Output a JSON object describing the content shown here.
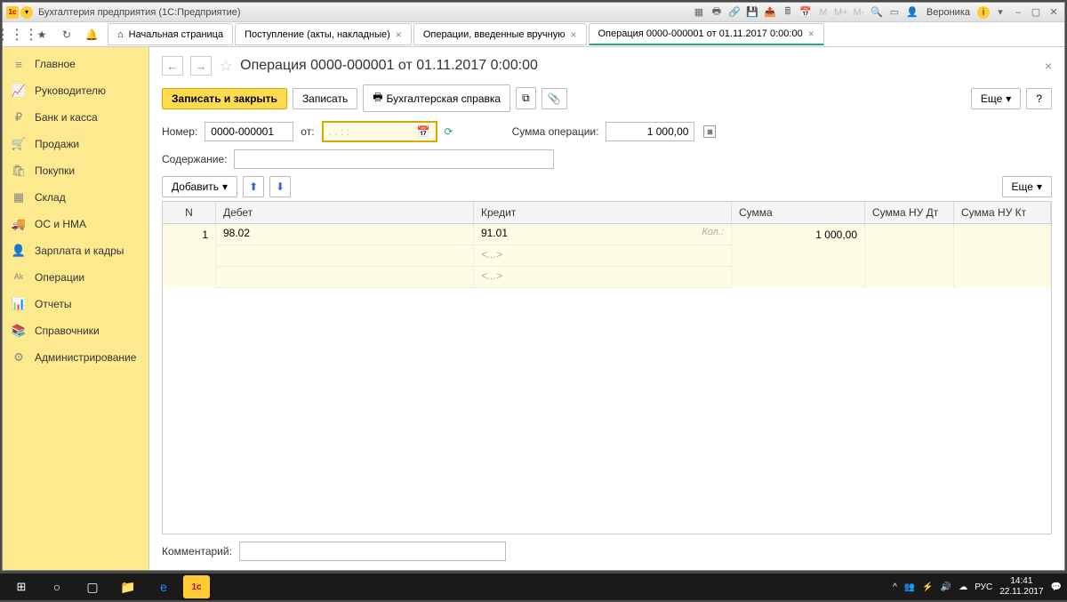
{
  "titlebar": {
    "app_icon": "1c",
    "text": "Бухгалтерия предприятия  (1С:Предприятие)",
    "user": "Вероника"
  },
  "toolbar": {
    "home_tab": "Начальная страница",
    "tabs": [
      "Поступление (акты, накладные)",
      "Операции, введенные вручную",
      "Операция 0000-000001 от 01.11.2017 0:00:00"
    ]
  },
  "sidebar": {
    "items": [
      {
        "icon": "≡",
        "label": "Главное"
      },
      {
        "icon": "📈",
        "label": "Руководителю"
      },
      {
        "icon": "₽",
        "label": "Банк и касса"
      },
      {
        "icon": "🛒",
        "label": "Продажи"
      },
      {
        "icon": "🛍",
        "label": "Покупки"
      },
      {
        "icon": "▦",
        "label": "Склад"
      },
      {
        "icon": "🚚",
        "label": "ОС и НМА"
      },
      {
        "icon": "👤",
        "label": "Зарплата и кадры"
      },
      {
        "icon": "ᴬᵏ",
        "label": "Операции"
      },
      {
        "icon": "📊",
        "label": "Отчеты"
      },
      {
        "icon": "📚",
        "label": "Справочники"
      },
      {
        "icon": "⚙",
        "label": "Администрирование"
      }
    ]
  },
  "page": {
    "title": "Операция 0000-000001 от 01.11.2017 0:00:00",
    "btn_save_close": "Записать и закрыть",
    "btn_save": "Записать",
    "btn_report": "Бухгалтерская справка",
    "btn_more": "Еще",
    "btn_help": "?",
    "lbl_number": "Номер:",
    "val_number": "0000-000001",
    "lbl_from": "от:",
    "val_date": ".  .        :  :",
    "lbl_sum": "Сумма операции:",
    "val_sum": "1 000,00",
    "lbl_content": "Содержание:",
    "btn_add": "Добавить",
    "lbl_comment": "Комментарий:"
  },
  "grid": {
    "headers": {
      "n": "N",
      "debit": "Дебет",
      "credit": "Кредит",
      "sum": "Сумма",
      "nu_dt": "Сумма НУ Дт",
      "nu_kt": "Сумма НУ Кт"
    },
    "row": {
      "n": "1",
      "debit": "98.02",
      "credit": "91.01",
      "kol": "Кол.:",
      "credit_sub1": "<...>",
      "credit_sub2": "<...>",
      "sum": "1 000,00"
    }
  },
  "taskbar": {
    "time": "14:41",
    "date": "22.11.2017",
    "lang": "РУС"
  }
}
